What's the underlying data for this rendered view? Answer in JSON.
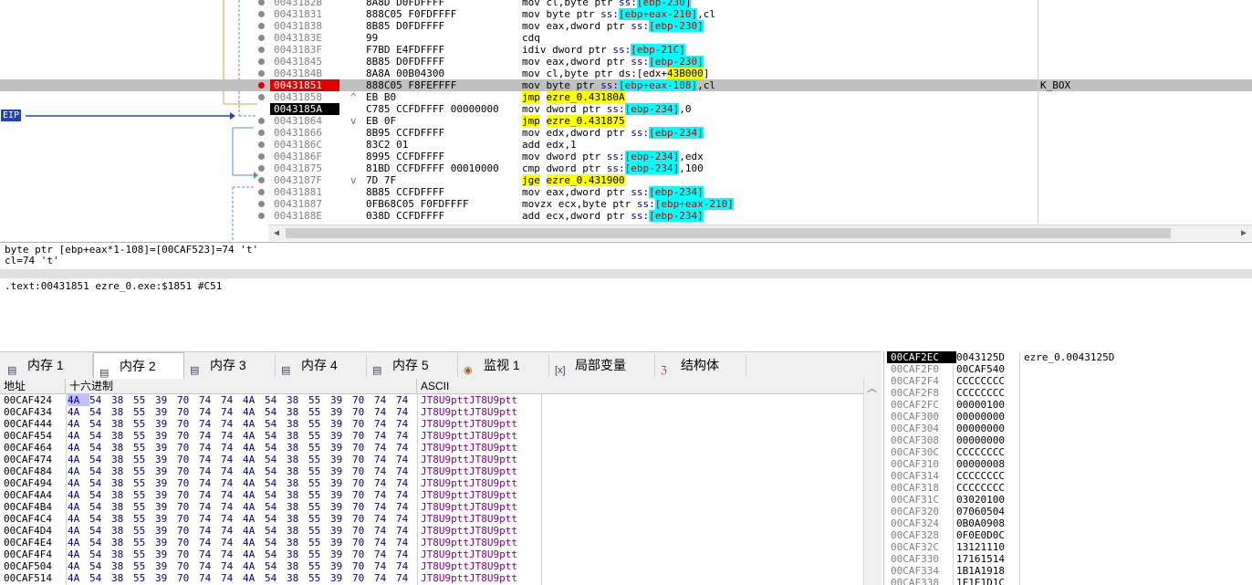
{
  "disassembly": {
    "eip_label": "EIP",
    "rows": [
      {
        "addr": "0043182B",
        "bytes": "8A8D D0FDFFFF",
        "mark": "",
        "instr": [
          {
            "t": "mov ",
            "c": "op"
          },
          {
            "t": "cl,byte ptr ",
            "c": "op"
          },
          {
            "t": "ss:",
            "c": "blue"
          },
          {
            "t": "[ebp-230]",
            "c": "cyanred"
          }
        ],
        "bp": "gray",
        "style": ""
      },
      {
        "addr": "00431831",
        "bytes": "888C05 F0FDFFFF",
        "mark": "",
        "instr": [
          {
            "t": "mov ",
            "c": "op"
          },
          {
            "t": "byte ptr ",
            "c": "op"
          },
          {
            "t": "ss:",
            "c": "blue"
          },
          {
            "t": "[ebp+eax-210]",
            "c": "cyanred"
          },
          {
            "t": ",cl",
            "c": "op"
          }
        ],
        "bp": "gray",
        "style": ""
      },
      {
        "addr": "00431838",
        "bytes": "8B85 D0FDFFFF",
        "mark": "",
        "instr": [
          {
            "t": "mov ",
            "c": "op"
          },
          {
            "t": "eax,dword ptr ",
            "c": "op"
          },
          {
            "t": "ss:",
            "c": "blue"
          },
          {
            "t": "[ebp-230]",
            "c": "cyanred"
          }
        ],
        "bp": "gray",
        "style": ""
      },
      {
        "addr": "0043183E",
        "bytes": "99",
        "mark": "",
        "instr": [
          {
            "t": "cdq",
            "c": "op"
          }
        ],
        "bp": "gray",
        "style": ""
      },
      {
        "addr": "0043183F",
        "bytes": "F7BD E4FDFFFF",
        "mark": "",
        "instr": [
          {
            "t": "idiv ",
            "c": "op"
          },
          {
            "t": "dword ptr ",
            "c": "op"
          },
          {
            "t": "ss:",
            "c": "blue"
          },
          {
            "t": "[ebp-21C]",
            "c": "cyanred"
          }
        ],
        "bp": "gray",
        "style": ""
      },
      {
        "addr": "00431845",
        "bytes": "8B85 D0FDFFFF",
        "mark": "",
        "instr": [
          {
            "t": "mov ",
            "c": "op"
          },
          {
            "t": "eax,dword ptr ",
            "c": "op"
          },
          {
            "t": "ss:",
            "c": "blue"
          },
          {
            "t": "[ebp-230]",
            "c": "cyanred"
          }
        ],
        "bp": "gray",
        "style": ""
      },
      {
        "addr": "0043184B",
        "bytes": "8A8A 00B04300",
        "mark": "",
        "instr": [
          {
            "t": "mov ",
            "c": "op"
          },
          {
            "t": "cl,byte ptr ",
            "c": "op"
          },
          {
            "t": "ds:",
            "c": "op"
          },
          {
            "t": "[edx+",
            "c": "op"
          },
          {
            "t": "43B000",
            "c": "yellow"
          },
          {
            "t": "]",
            "c": "op"
          }
        ],
        "bp": "gray",
        "style": ""
      },
      {
        "addr": "00431851",
        "bytes": "888C05 F8FEFFFF",
        "mark": "",
        "instr": [
          {
            "t": "mov ",
            "c": "op"
          },
          {
            "t": "byte ptr ",
            "c": "op"
          },
          {
            "t": "ss:",
            "c": "blue"
          },
          {
            "t": "[ebp+eax-108]",
            "c": "cyanred"
          },
          {
            "t": ",cl",
            "c": "op"
          }
        ],
        "bp": "red",
        "style": "sel",
        "addrstyle": "red",
        "comment": "K_BOX"
      },
      {
        "addr": "00431858",
        "bytes": "EB B0",
        "mark": "^",
        "instr": [
          {
            "t": "jmp",
            "c": "yellow"
          },
          {
            "t": " ",
            "c": "op"
          },
          {
            "t": "ezre_0.43180A",
            "c": "yellow"
          }
        ],
        "bp": "gray",
        "style": ""
      },
      {
        "addr": "0043185A",
        "bytes": "C785 CCFDFFFF 00000000",
        "mark": "",
        "instr": [
          {
            "t": "mov ",
            "c": "op"
          },
          {
            "t": "dword ptr ",
            "c": "op"
          },
          {
            "t": "ss:",
            "c": "blue"
          },
          {
            "t": "[ebp-234]",
            "c": "cyanred"
          },
          {
            "t": ",0",
            "c": "op"
          }
        ],
        "bp": "none",
        "style": "",
        "addrstyle": "black"
      },
      {
        "addr": "00431864",
        "bytes": "EB 0F",
        "mark": "v",
        "instr": [
          {
            "t": "jmp",
            "c": "yellow"
          },
          {
            "t": " ",
            "c": "op"
          },
          {
            "t": "ezre_0.431875",
            "c": "yellow"
          }
        ],
        "bp": "gray",
        "style": ""
      },
      {
        "addr": "00431866",
        "bytes": "8B95 CCFDFFFF",
        "mark": "",
        "instr": [
          {
            "t": "mov ",
            "c": "op"
          },
          {
            "t": "edx,dword ptr ",
            "c": "op"
          },
          {
            "t": "ss:",
            "c": "blue"
          },
          {
            "t": "[ebp-234]",
            "c": "cyanred"
          }
        ],
        "bp": "gray",
        "style": ""
      },
      {
        "addr": "0043186C",
        "bytes": "83C2 01",
        "mark": "",
        "instr": [
          {
            "t": "add ",
            "c": "op"
          },
          {
            "t": "edx,1",
            "c": "op"
          }
        ],
        "bp": "gray",
        "style": ""
      },
      {
        "addr": "0043186F",
        "bytes": "8995 CCFDFFFF",
        "mark": "",
        "instr": [
          {
            "t": "mov ",
            "c": "op"
          },
          {
            "t": "dword ptr ",
            "c": "op"
          },
          {
            "t": "ss:",
            "c": "blue"
          },
          {
            "t": "[ebp-234]",
            "c": "cyanred"
          },
          {
            "t": ",edx",
            "c": "op"
          }
        ],
        "bp": "gray",
        "style": ""
      },
      {
        "addr": "00431875",
        "bytes": "81BD CCFDFFFF 00010000",
        "mark": "",
        "instr": [
          {
            "t": "cmp ",
            "c": "op"
          },
          {
            "t": "dword ptr ",
            "c": "op"
          },
          {
            "t": "ss:",
            "c": "blue"
          },
          {
            "t": "[ebp-234]",
            "c": "cyanred"
          },
          {
            "t": ",100",
            "c": "op"
          }
        ],
        "bp": "gray",
        "style": ""
      },
      {
        "addr": "0043187F",
        "bytes": "7D 7F",
        "mark": "v",
        "instr": [
          {
            "t": "jge",
            "c": "yellow"
          },
          {
            "t": " ",
            "c": "op"
          },
          {
            "t": "ezre_0.431900",
            "c": "yellow"
          }
        ],
        "bp": "gray",
        "style": ""
      },
      {
        "addr": "00431881",
        "bytes": "8B85 CCFDFFFF",
        "mark": "",
        "instr": [
          {
            "t": "mov ",
            "c": "op"
          },
          {
            "t": "eax,dword ptr ",
            "c": "op"
          },
          {
            "t": "ss:",
            "c": "blue"
          },
          {
            "t": "[ebp-234]",
            "c": "cyanred"
          }
        ],
        "bp": "gray",
        "style": ""
      },
      {
        "addr": "00431887",
        "bytes": "0FB68C05 F0FDFFFF",
        "mark": "",
        "instr": [
          {
            "t": "movzx ",
            "c": "op"
          },
          {
            "t": "ecx,byte ptr ",
            "c": "op"
          },
          {
            "t": "ss:",
            "c": "blue"
          },
          {
            "t": "[ebp+eax-210]",
            "c": "cyanred"
          }
        ],
        "bp": "gray",
        "style": ""
      },
      {
        "addr": "0043188E",
        "bytes": "038D CCFDFFFF",
        "mark": "",
        "instr": [
          {
            "t": "add ",
            "c": "op"
          },
          {
            "t": "ecx,dword ptr ",
            "c": "op"
          },
          {
            "t": "ss:",
            "c": "blue"
          },
          {
            "t": "[ebp-234]",
            "c": "cyanred"
          }
        ],
        "bp": "gray",
        "style": ""
      }
    ]
  },
  "info": {
    "line1": "byte ptr [ebp+eax*1-108]=[00CAF523]=74 't'",
    "line2": "cl=74 't'",
    "line3": ".text:00431851 ezre_0.exe:$1851 #C51"
  },
  "tabs": [
    {
      "label": "内存 1",
      "icon": "memory-icon",
      "active": false
    },
    {
      "label": "内存 2",
      "icon": "memory-icon",
      "active": true
    },
    {
      "label": "内存 3",
      "icon": "memory-icon",
      "active": false
    },
    {
      "label": "内存 4",
      "icon": "memory-icon",
      "active": false
    },
    {
      "label": "内存 5",
      "icon": "memory-icon",
      "active": false
    },
    {
      "label": "监视 1",
      "icon": "watch-icon",
      "active": false
    },
    {
      "label": "局部变量",
      "icon": "locals-icon",
      "active": false
    },
    {
      "label": "结构体",
      "icon": "struct-icon",
      "active": false
    }
  ],
  "dump": {
    "headers": {
      "addr": "地址",
      "hex": "十六进制",
      "ascii": "ASCII"
    },
    "hex": [
      "4A",
      "54",
      "38",
      "55",
      "39",
      "70",
      "74",
      "74",
      "4A",
      "54",
      "38",
      "55",
      "39",
      "70",
      "74",
      "74"
    ],
    "ascii": "JT8U9pttJT8U9ptt",
    "addresses": [
      "00CAF424",
      "00CAF434",
      "00CAF444",
      "00CAF454",
      "00CAF464",
      "00CAF474",
      "00CAF484",
      "00CAF494",
      "00CAF4A4",
      "00CAF4B4",
      "00CAF4C4",
      "00CAF4D4",
      "00CAF4E4",
      "00CAF4F4",
      "00CAF504",
      "00CAF514"
    ]
  },
  "stack": {
    "rows": [
      {
        "addr": "00CAF2EC",
        "val": "0043125D",
        "cmt": "ezre_0.0043125D"
      },
      {
        "addr": "00CAF2F0",
        "val": "00CAF540",
        "cmt": ""
      },
      {
        "addr": "00CAF2F4",
        "val": "CCCCCCCC",
        "cmt": ""
      },
      {
        "addr": "00CAF2F8",
        "val": "CCCCCCCC",
        "cmt": ""
      },
      {
        "addr": "00CAF2FC",
        "val": "00000100",
        "cmt": ""
      },
      {
        "addr": "00CAF300",
        "val": "00000000",
        "cmt": ""
      },
      {
        "addr": "00CAF304",
        "val": "00000000",
        "cmt": ""
      },
      {
        "addr": "00CAF308",
        "val": "00000000",
        "cmt": ""
      },
      {
        "addr": "00CAF30C",
        "val": "CCCCCCCC",
        "cmt": ""
      },
      {
        "addr": "00CAF310",
        "val": "00000008",
        "cmt": ""
      },
      {
        "addr": "00CAF314",
        "val": "CCCCCCCC",
        "cmt": ""
      },
      {
        "addr": "00CAF318",
        "val": "CCCCCCCC",
        "cmt": ""
      },
      {
        "addr": "00CAF31C",
        "val": "03020100",
        "cmt": ""
      },
      {
        "addr": "00CAF320",
        "val": "07060504",
        "cmt": ""
      },
      {
        "addr": "00CAF324",
        "val": "0B0A0908",
        "cmt": ""
      },
      {
        "addr": "00CAF328",
        "val": "0F0E0D0C",
        "cmt": ""
      },
      {
        "addr": "00CAF32C",
        "val": "13121110",
        "cmt": ""
      },
      {
        "addr": "00CAF330",
        "val": "17161514",
        "cmt": ""
      },
      {
        "addr": "00CAF334",
        "val": "1B1A1918",
        "cmt": ""
      },
      {
        "addr": "00CAF338",
        "val": "1F1E1D1C",
        "cmt": ""
      }
    ]
  }
}
